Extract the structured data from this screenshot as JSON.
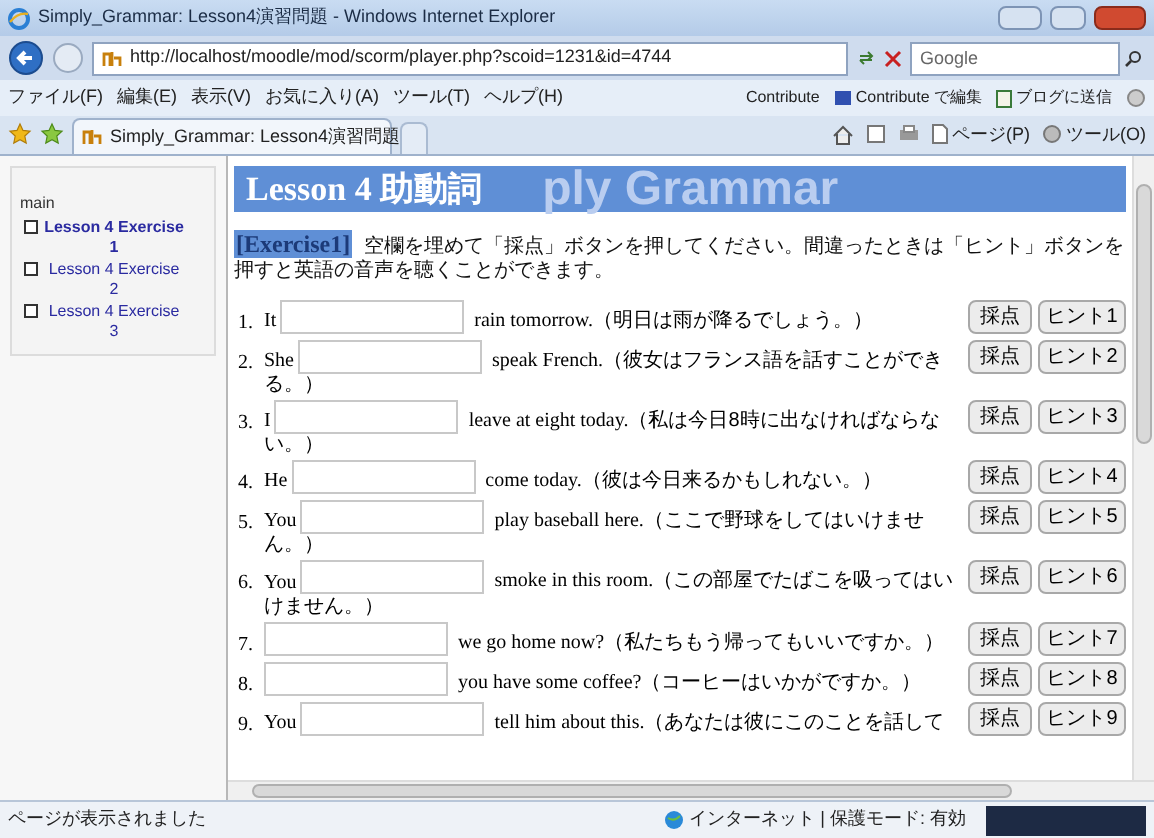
{
  "window": {
    "title": "Simply_Grammar: Lesson4演習問題 - Windows Internet Explorer"
  },
  "address_bar": {
    "url": "http://localhost/moodle/mod/scorm/player.php?scoid=1231&id=4744",
    "search_placeholder": "Google"
  },
  "menu": [
    "ファイル(F)",
    "編集(E)",
    "表示(V)",
    "お気に入り(A)",
    "ツール(T)",
    "ヘルプ(H)"
  ],
  "contribute": {
    "label": "Contribute",
    "edit": "Contribute で編集",
    "blog": "ブログに送信"
  },
  "tab": {
    "title": "Simply_Grammar: Lesson4演習問題"
  },
  "command_bar": {
    "page": "ページ(P)",
    "tools": "ツール(O)"
  },
  "sidebar": {
    "root": "main",
    "items": [
      {
        "label": "Lesson 4 Exercise 1",
        "selected": true
      },
      {
        "label": "Lesson 4 Exercise 2",
        "selected": false
      },
      {
        "label": "Lesson 4 Exercise 3",
        "selected": false
      }
    ]
  },
  "lesson": {
    "title": "Lesson 4 助動詞",
    "banner_text": "ply Grammar",
    "exercise_label": "[Exercise1]",
    "instructions": "空欄を埋めて「採点」ボタンを押してください。間違ったときは「ヒント」ボタンを押すと英語の音声を聴くことができます。",
    "questions": [
      {
        "number": "1.",
        "before": "It",
        "after": "rain tomorrow.",
        "translation": "（明日は雨が降るでしょう。）",
        "score": "採点",
        "hint": "ヒント1"
      },
      {
        "number": "2.",
        "before": "She",
        "after": "speak French.",
        "translation": "（彼女はフランス語を話すことができる。）",
        "score": "採点",
        "hint": "ヒント2"
      },
      {
        "number": "3.",
        "before": "I",
        "after": "leave at eight today.",
        "translation": "（私は今日8時に出なければならない。）",
        "score": "採点",
        "hint": "ヒント3"
      },
      {
        "number": "4.",
        "before": "He",
        "after": "come today.",
        "translation": "（彼は今日来るかもしれない。）",
        "score": "採点",
        "hint": "ヒント4"
      },
      {
        "number": "5.",
        "before": "You",
        "after": "play baseball here.",
        "translation": "（ここで野球をしてはいけません。）",
        "score": "採点",
        "hint": "ヒント5"
      },
      {
        "number": "6.",
        "before": "You",
        "after": "smoke in this room.",
        "translation": "（この部屋でたばこを吸ってはいけません。）",
        "score": "採点",
        "hint": "ヒント6"
      },
      {
        "number": "7.",
        "after": "we go home now?",
        "translation": "（私たちもう帰ってもいいですか。）",
        "score": "採点",
        "hint": "ヒント7"
      },
      {
        "number": "8.",
        "after": "you have some coffee?",
        "translation": "（コーヒーはいかがですか。）",
        "score": "採点",
        "hint": "ヒント8"
      },
      {
        "number": "9.",
        "before": "You",
        "after": "tell him about this.",
        "translation": "（あなたは彼にこのことを話して",
        "score": "採点",
        "hint": "ヒント9"
      }
    ]
  },
  "status_bar": {
    "text": "ページが表示されました",
    "zone": "インターネット | 保護モード: 有効"
  }
}
